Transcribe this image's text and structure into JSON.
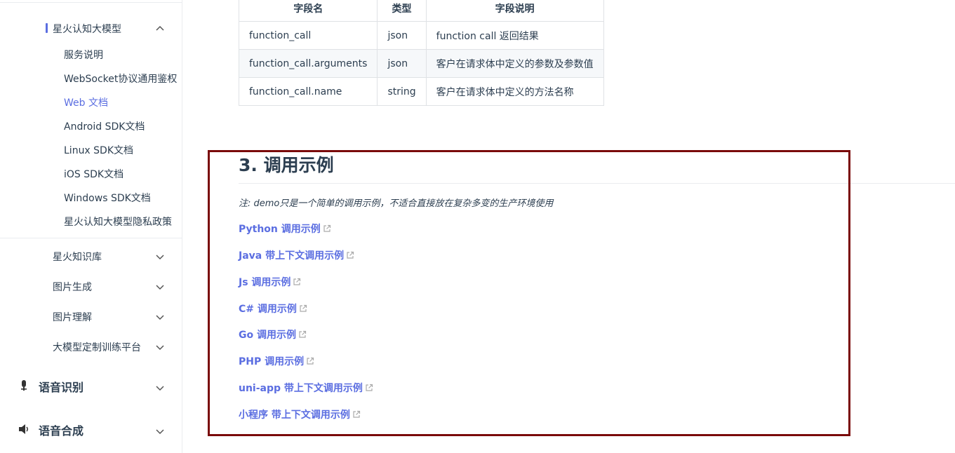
{
  "sidebar": {
    "open_group": {
      "label": "星火认知大模型",
      "items": [
        {
          "label": "服务说明",
          "active": false
        },
        {
          "label": "WebSocket协议通用鉴权",
          "active": false
        },
        {
          "label": "Web 文档",
          "active": true
        },
        {
          "label": "Android SDK文档",
          "active": false
        },
        {
          "label": "Linux SDK文档",
          "active": false
        },
        {
          "label": "iOS SDK文档",
          "active": false
        },
        {
          "label": "Windows SDK文档",
          "active": false
        },
        {
          "label": "星火认知大模型隐私政策",
          "active": false
        }
      ]
    },
    "collapsed_groups": [
      {
        "label": "星火知识库"
      },
      {
        "label": "图片生成"
      },
      {
        "label": "图片理解"
      },
      {
        "label": "大模型定制训练平台"
      }
    ],
    "sections": [
      {
        "label": "语音识别",
        "icon": "microphone-icon"
      },
      {
        "label": "语音合成",
        "icon": "speaker-icon"
      }
    ],
    "accent_color": "#5b6ee1"
  },
  "table": {
    "headers": [
      "字段名",
      "类型",
      "字段说明"
    ],
    "rows": [
      [
        "function_call",
        "json",
        "function call 返回结果"
      ],
      [
        "function_call.arguments",
        "json",
        "客户在请求体中定义的参数及参数值"
      ],
      [
        "function_call.name",
        "string",
        "客户在请求体中定义的方法名称"
      ]
    ]
  },
  "section": {
    "title": "3. 调用示例",
    "note": "注: demo只是一个简单的调用示例，不适合直接放在复杂多变的生产环境使用",
    "links": [
      "Python 调用示例",
      "Java 带上下文调用示例",
      "Js 调用示例",
      "C# 调用示例",
      "Go 调用示例",
      "PHP 调用示例",
      "uni-app 带上下文调用示例",
      "小程序 带上下文调用示例"
    ]
  },
  "colors": {
    "link": "#5b6ee1",
    "highlight_border": "#7a0a0a",
    "text": "#2c3e50"
  }
}
